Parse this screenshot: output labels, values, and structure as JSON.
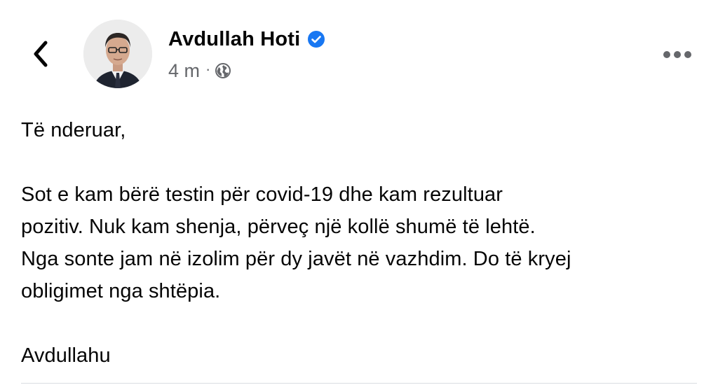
{
  "post": {
    "author": {
      "name": "Avdullah Hoti",
      "verified": true
    },
    "meta": {
      "time": "4 m",
      "separator": "·",
      "audience_icon": "globe-icon"
    },
    "body": {
      "greeting": "Të nderuar,",
      "line_1": "Sot e kam bërë testin për covid-19 dhe kam rezultuar",
      "line_2": "pozitiv. Nuk kam shenja, përveç një kollë shumë të lehtë.",
      "line_3": "Nga sonte jam në izolim për dy javët në vazhdim. Do të kryej",
      "line_4": "obligimet nga shtëpia.",
      "signature": "Avdullahu"
    }
  },
  "icons": {
    "back": "chevron-left-icon",
    "more": "more-horizontal-icon",
    "verified": "verified-badge-icon"
  },
  "colors": {
    "text": "#050505",
    "secondary_text": "#65676b",
    "verified_blue": "#1877f2",
    "divider": "#dadde1"
  }
}
